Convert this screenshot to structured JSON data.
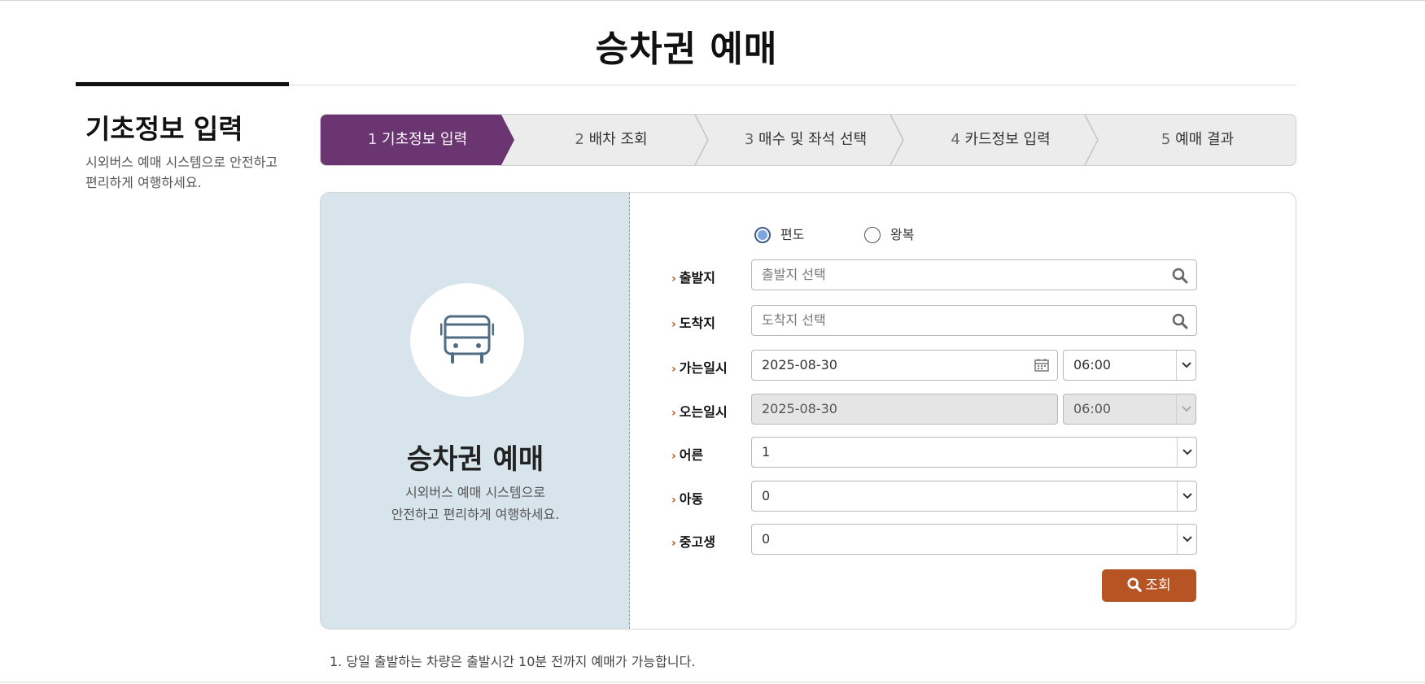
{
  "page": {
    "title": "승차권 예매"
  },
  "side": {
    "title": "기초정보 입력",
    "desc": "시외버스 예매 시스템으로 안전하고 편리하게 여행하세요."
  },
  "steps": [
    {
      "num": "1",
      "label": "기초정보 입력",
      "active": true
    },
    {
      "num": "2",
      "label": "배차 조회",
      "active": false
    },
    {
      "num": "3",
      "label": "매수 및 좌석 선택",
      "active": false
    },
    {
      "num": "4",
      "label": "카드정보 입력",
      "active": false
    },
    {
      "num": "5",
      "label": "예매 결과",
      "active": false
    }
  ],
  "promo": {
    "icon": "bus-icon",
    "title": "승차권 예매",
    "desc_line1": "시외버스 예매 시스템으로",
    "desc_line2": "안전하고 편리하게 여행하세요."
  },
  "trip_type": {
    "one_way": "편도",
    "round_trip": "왕복",
    "selected": "편도"
  },
  "form": {
    "departure": {
      "label": "출발지",
      "placeholder": "출발지 선택",
      "icon": "search-icon"
    },
    "arrival": {
      "label": "도착지",
      "placeholder": "도착지 선택",
      "icon": "search-icon"
    },
    "go_datetime": {
      "label": "가는일시",
      "date": "2025-08-30",
      "time": "06:00",
      "icon": "calendar-icon"
    },
    "return_datetime": {
      "label": "오는일시",
      "date": "2025-08-30",
      "time": "06:00",
      "disabled": true
    },
    "adult": {
      "label": "어른",
      "value": "1"
    },
    "child": {
      "label": "아동",
      "value": "0"
    },
    "student": {
      "label": "중고생",
      "value": "0"
    }
  },
  "search_button": {
    "label": "조회",
    "icon": "search-icon"
  },
  "notice": "1. 당일 출발하는 차량은 출발시간 10분 전까지 예매가 가능합니다.",
  "colors": {
    "active_step": "#6b3572",
    "accent": "#b65424",
    "promo_bg": "#d7e4ec"
  }
}
